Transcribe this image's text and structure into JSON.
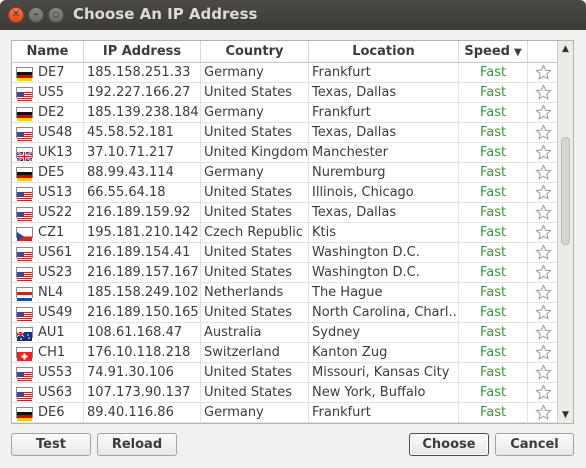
{
  "window": {
    "title": "Choose An IP Address"
  },
  "columns": {
    "name": "Name",
    "ip": "IP Address",
    "country": "Country",
    "location": "Location",
    "speed": "Speed"
  },
  "rows": [
    {
      "flag": "de",
      "name": "DE7",
      "ip": "185.158.251.33",
      "country": "Germany",
      "location": "Frankfurt",
      "speed": "Fast"
    },
    {
      "flag": "us",
      "name": "US5",
      "ip": "192.227.166.27",
      "country": "United States",
      "location": "Texas, Dallas",
      "speed": "Fast"
    },
    {
      "flag": "de",
      "name": "DE2",
      "ip": "185.139.238.184",
      "country": "Germany",
      "location": "Frankfurt",
      "speed": "Fast"
    },
    {
      "flag": "us",
      "name": "US48",
      "ip": "45.58.52.181",
      "country": "United States",
      "location": "Texas, Dallas",
      "speed": "Fast"
    },
    {
      "flag": "uk",
      "name": "UK13",
      "ip": "37.10.71.217",
      "country": "United Kingdom",
      "location": "Manchester",
      "speed": "Fast"
    },
    {
      "flag": "de",
      "name": "DE5",
      "ip": "88.99.43.114",
      "country": "Germany",
      "location": "Nuremburg",
      "speed": "Fast"
    },
    {
      "flag": "us",
      "name": "US13",
      "ip": "66.55.64.18",
      "country": "United States",
      "location": "Illinois, Chicago",
      "speed": "Fast"
    },
    {
      "flag": "us",
      "name": "US22",
      "ip": "216.189.159.92",
      "country": "United States",
      "location": "Texas, Dallas",
      "speed": "Fast"
    },
    {
      "flag": "cz",
      "name": "CZ1",
      "ip": "195.181.210.142",
      "country": "Czech Republic",
      "location": "Ktis",
      "speed": "Fast"
    },
    {
      "flag": "us",
      "name": "US61",
      "ip": "216.189.154.41",
      "country": "United States",
      "location": "Washington D.C.",
      "speed": "Fast"
    },
    {
      "flag": "us",
      "name": "US23",
      "ip": "216.189.157.167",
      "country": "United States",
      "location": "Washington D.C.",
      "speed": "Fast"
    },
    {
      "flag": "nl",
      "name": "NL4",
      "ip": "185.158.249.102",
      "country": "Netherlands",
      "location": "The Hague",
      "speed": "Fast"
    },
    {
      "flag": "us",
      "name": "US49",
      "ip": "216.189.150.165",
      "country": "United States",
      "location": "North Carolina, Charl...",
      "speed": "Fast"
    },
    {
      "flag": "au",
      "name": "AU1",
      "ip": "108.61.168.47",
      "country": "Australia",
      "location": "Sydney",
      "speed": "Fast"
    },
    {
      "flag": "ch",
      "name": "CH1",
      "ip": "176.10.118.218",
      "country": "Switzerland",
      "location": "Kanton Zug",
      "speed": "Fast"
    },
    {
      "flag": "us",
      "name": "US53",
      "ip": "74.91.30.106",
      "country": "United States",
      "location": "Missouri, Kansas City",
      "speed": "Fast"
    },
    {
      "flag": "us",
      "name": "US63",
      "ip": "107.173.90.137",
      "country": "United States",
      "location": "New York, Buffalo",
      "speed": "Fast"
    },
    {
      "flag": "de",
      "name": "DE6",
      "ip": "89.40.116.86",
      "country": "Germany",
      "location": "Frankfurt",
      "speed": "Fast"
    }
  ],
  "buttons": {
    "test": "Test",
    "reload": "Reload",
    "choose": "Choose",
    "cancel": "Cancel"
  },
  "colors": {
    "speed_fast": "#3a9a3a"
  }
}
